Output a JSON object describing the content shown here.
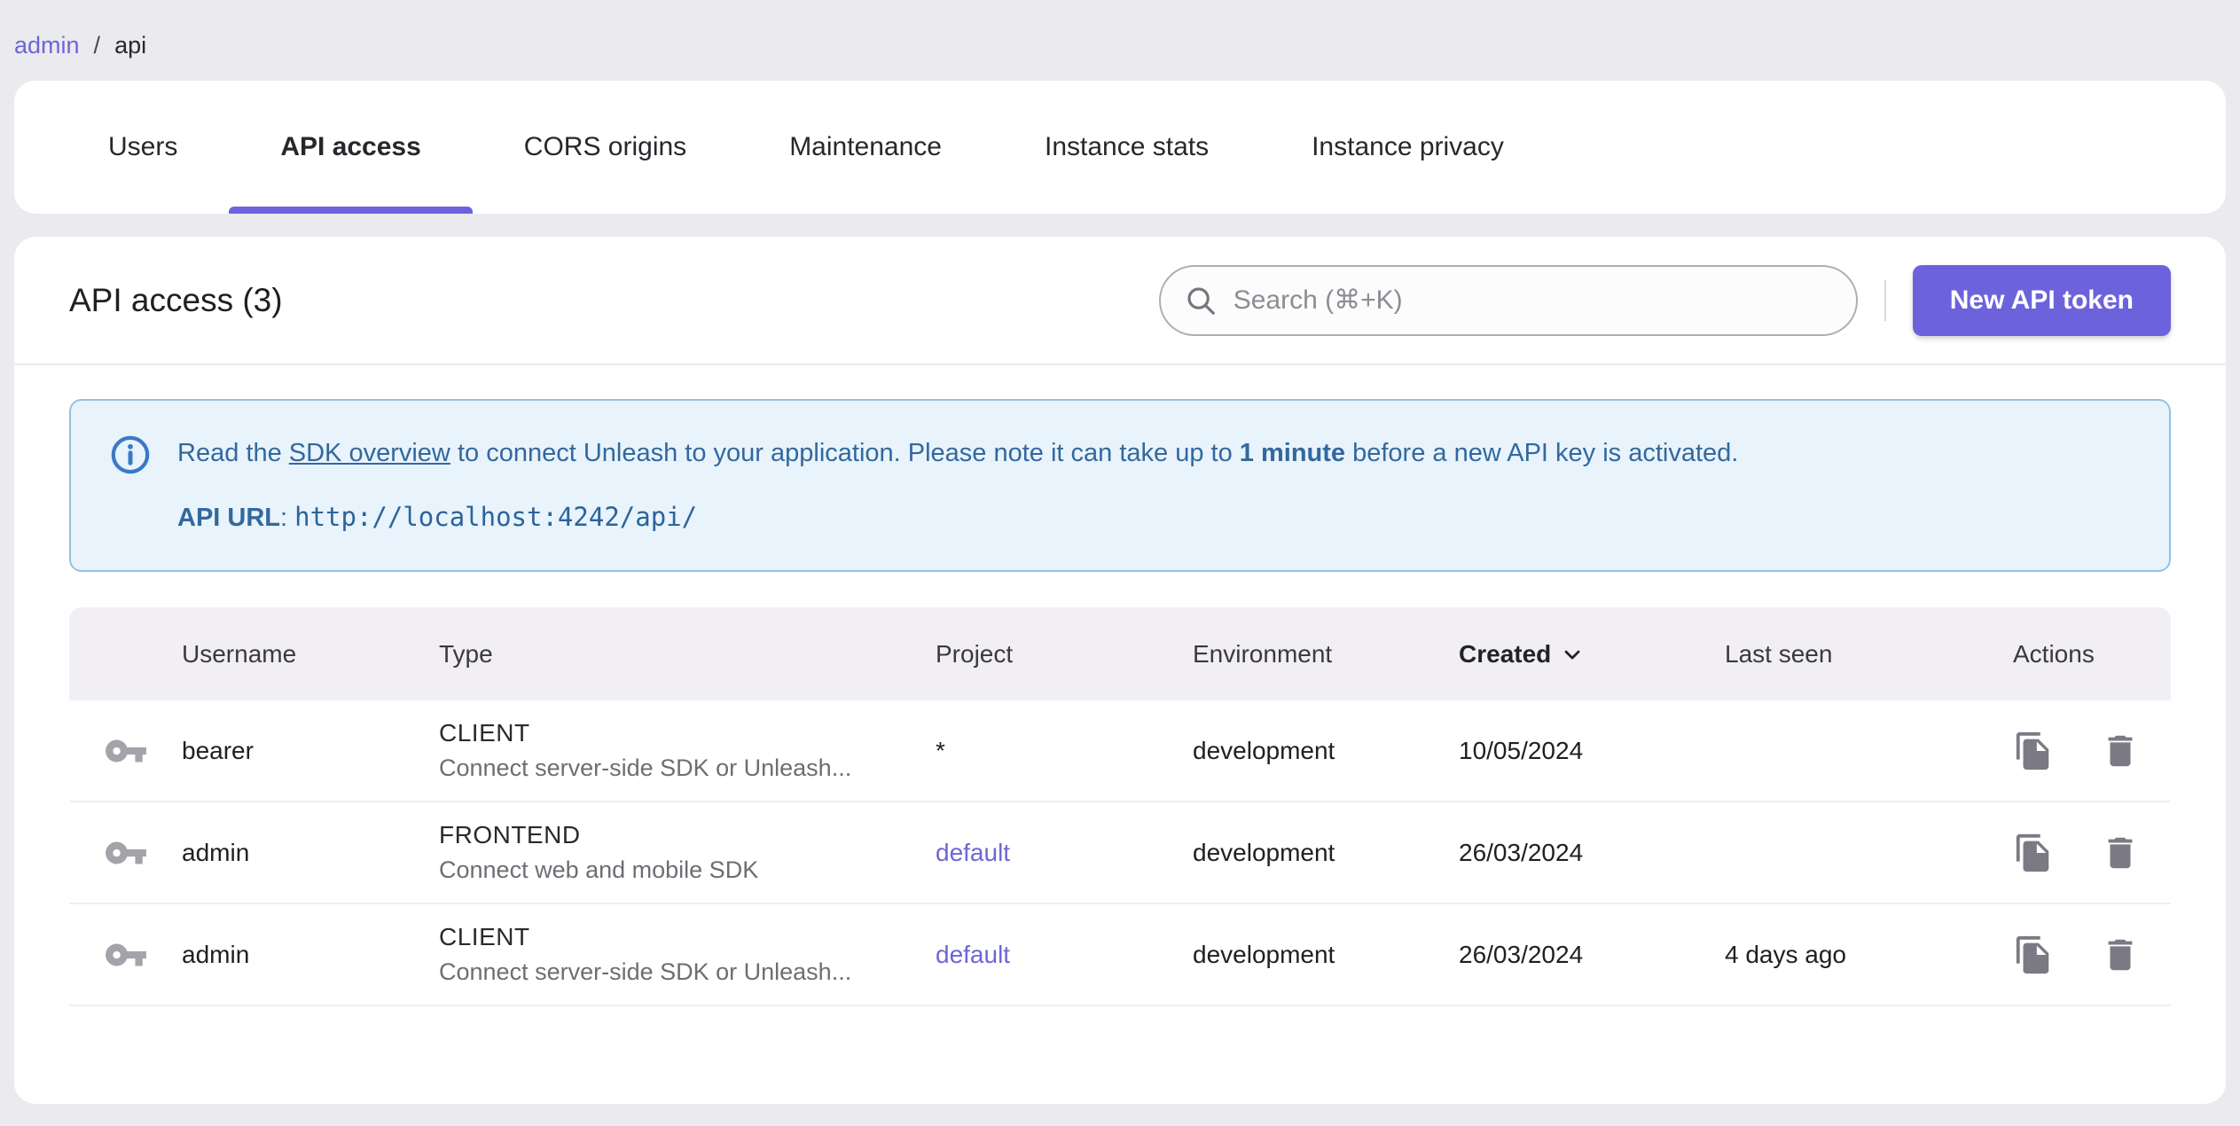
{
  "breadcrumb": {
    "root": "admin",
    "separator": "/",
    "current": "api"
  },
  "tabs": [
    {
      "label": "Users",
      "active": false
    },
    {
      "label": "API access",
      "active": true
    },
    {
      "label": "CORS origins",
      "active": false
    },
    {
      "label": "Maintenance",
      "active": false
    },
    {
      "label": "Instance stats",
      "active": false
    },
    {
      "label": "Instance privacy",
      "active": false
    }
  ],
  "header": {
    "title": "API access (3)",
    "search_placeholder": "Search (⌘+K)",
    "new_token_button": "New API token"
  },
  "alert": {
    "text_prefix": "Read the ",
    "link": "SDK overview",
    "text_mid": " to connect Unleash to your application. Please note it can take up to ",
    "bold": "1 minute",
    "text_suffix": " before a new API key is activated.",
    "api_url_label": "API URL",
    "api_url_sep": ": ",
    "api_url": "http://localhost:4242/api/"
  },
  "table": {
    "columns": {
      "username": "Username",
      "type": "Type",
      "project": "Project",
      "environment": "Environment",
      "created": "Created",
      "last_seen": "Last seen",
      "actions": "Actions"
    },
    "sorted_by": "Created",
    "rows": [
      {
        "username": "bearer",
        "type": "CLIENT",
        "type_description": "Connect server-side SDK or Unleash...",
        "project": "*",
        "environment": "development",
        "created": "10/05/2024",
        "last_seen": ""
      },
      {
        "username": "admin",
        "type": "FRONTEND",
        "type_description": "Connect web and mobile SDK",
        "project": "default",
        "environment": "development",
        "created": "26/03/2024",
        "last_seen": ""
      },
      {
        "username": "admin",
        "type": "CLIENT",
        "type_description": "Connect server-side SDK or Unleash...",
        "project": "default",
        "environment": "development",
        "created": "26/03/2024",
        "last_seen": "4 days ago"
      }
    ]
  },
  "icons": {
    "search": "magnifier",
    "info": "info-circle",
    "key": "api-key",
    "copy": "copy-token",
    "delete": "trash",
    "sort": "chevron-down"
  },
  "colors": {
    "accent": "#6c63dc",
    "link": "#6e66d4",
    "page_bg": "#ebeaef",
    "alert_bg": "#e8f3fb",
    "alert_border": "#97c0e0",
    "alert_text": "#33689e",
    "table_header_bg": "#f1eff4"
  }
}
